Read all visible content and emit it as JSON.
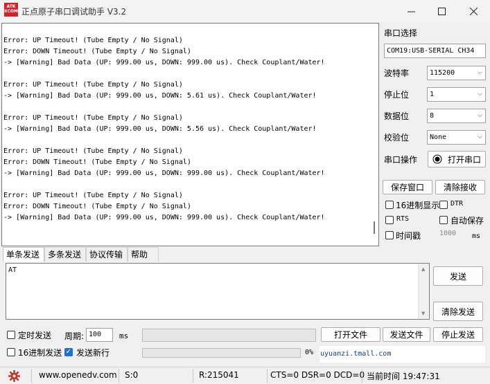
{
  "window": {
    "title": "正点原子串口调试助手 V3.2",
    "logo_line1": "ATK",
    "logo_line2": "XCOM"
  },
  "receive": {
    "lines": [
      "Error: UP Timeout! (Tube Empty / No Signal)",
      "Error: DOWN Timeout! (Tube Empty / No Signal)",
      "-> [Warning] Bad Data (UP: 999.00 us, DOWN: 999.00 us). Check Couplant/Water!",
      "",
      "Error: UP Timeout! (Tube Empty / No Signal)",
      "-> [Warning] Bad Data (UP: 999.00 us, DOWN: 5.61 us). Check Couplant/Water!",
      "",
      "Error: UP Timeout! (Tube Empty / No Signal)",
      "-> [Warning] Bad Data (UP: 999.00 us, DOWN: 5.56 us). Check Couplant/Water!",
      "",
      "Error: UP Timeout! (Tube Empty / No Signal)",
      "Error: DOWN Timeout! (Tube Empty / No Signal)",
      "-> [Warning] Bad Data (UP: 999.00 us, DOWN: 999.00 us). Check Couplant/Water!",
      "",
      "Error: UP Timeout! (Tube Empty / No Signal)",
      "Error: DOWN Timeout! (Tube Empty / No Signal)",
      "-> [Warning] Bad Data (UP: 999.00 us, DOWN: 999.00 us). Check Couplant/Water!"
    ]
  },
  "serial": {
    "port_label": "串口选择",
    "port_value": "COM19:USB-SERIAL CH34",
    "baud_label": "波特率",
    "baud_value": "115200",
    "stop_label": "停止位",
    "stop_value": "1",
    "data_label": "数据位",
    "data_value": "8",
    "parity_label": "校验位",
    "parity_value": "None",
    "op_label": "串口操作",
    "open_button": "打开串口"
  },
  "receive_controls": {
    "save_window": "保存窗口",
    "clear_receive": "清除接收",
    "hex_display": "16进制显示",
    "dtr": "DTR",
    "rts": "RTS",
    "auto_save": "自动保存",
    "timestamp": "时间戳",
    "timestamp_ms": "1000",
    "ms_unit": "ms"
  },
  "tabs": [
    "单条发送",
    "多条发送",
    "协议传输",
    "帮助"
  ],
  "send": {
    "text": "AT",
    "send_button": "发送",
    "clear_send_button": "清除发送",
    "timed_send": "定时发送",
    "period_label": "周期:",
    "period_value": "100",
    "period_unit": "ms",
    "open_file": "打开文件",
    "send_file": "发送文件",
    "stop_send": "停止发送",
    "hex_send": "16进制发送",
    "send_newline": "发送新行",
    "progress_text": "0%",
    "progress": 0,
    "link_text": "uyuanzi.tmall.com"
  },
  "status": {
    "url": "www.openedv.com",
    "sent": "S:0",
    "received": "R:215041",
    "lines": "CTS=0 DSR=0 DCD=0",
    "time": "当前时间 19:47:31"
  },
  "colors": {
    "accent": "#1e6fd9",
    "gear": "#c0392b",
    "logo": "#d2232a"
  }
}
